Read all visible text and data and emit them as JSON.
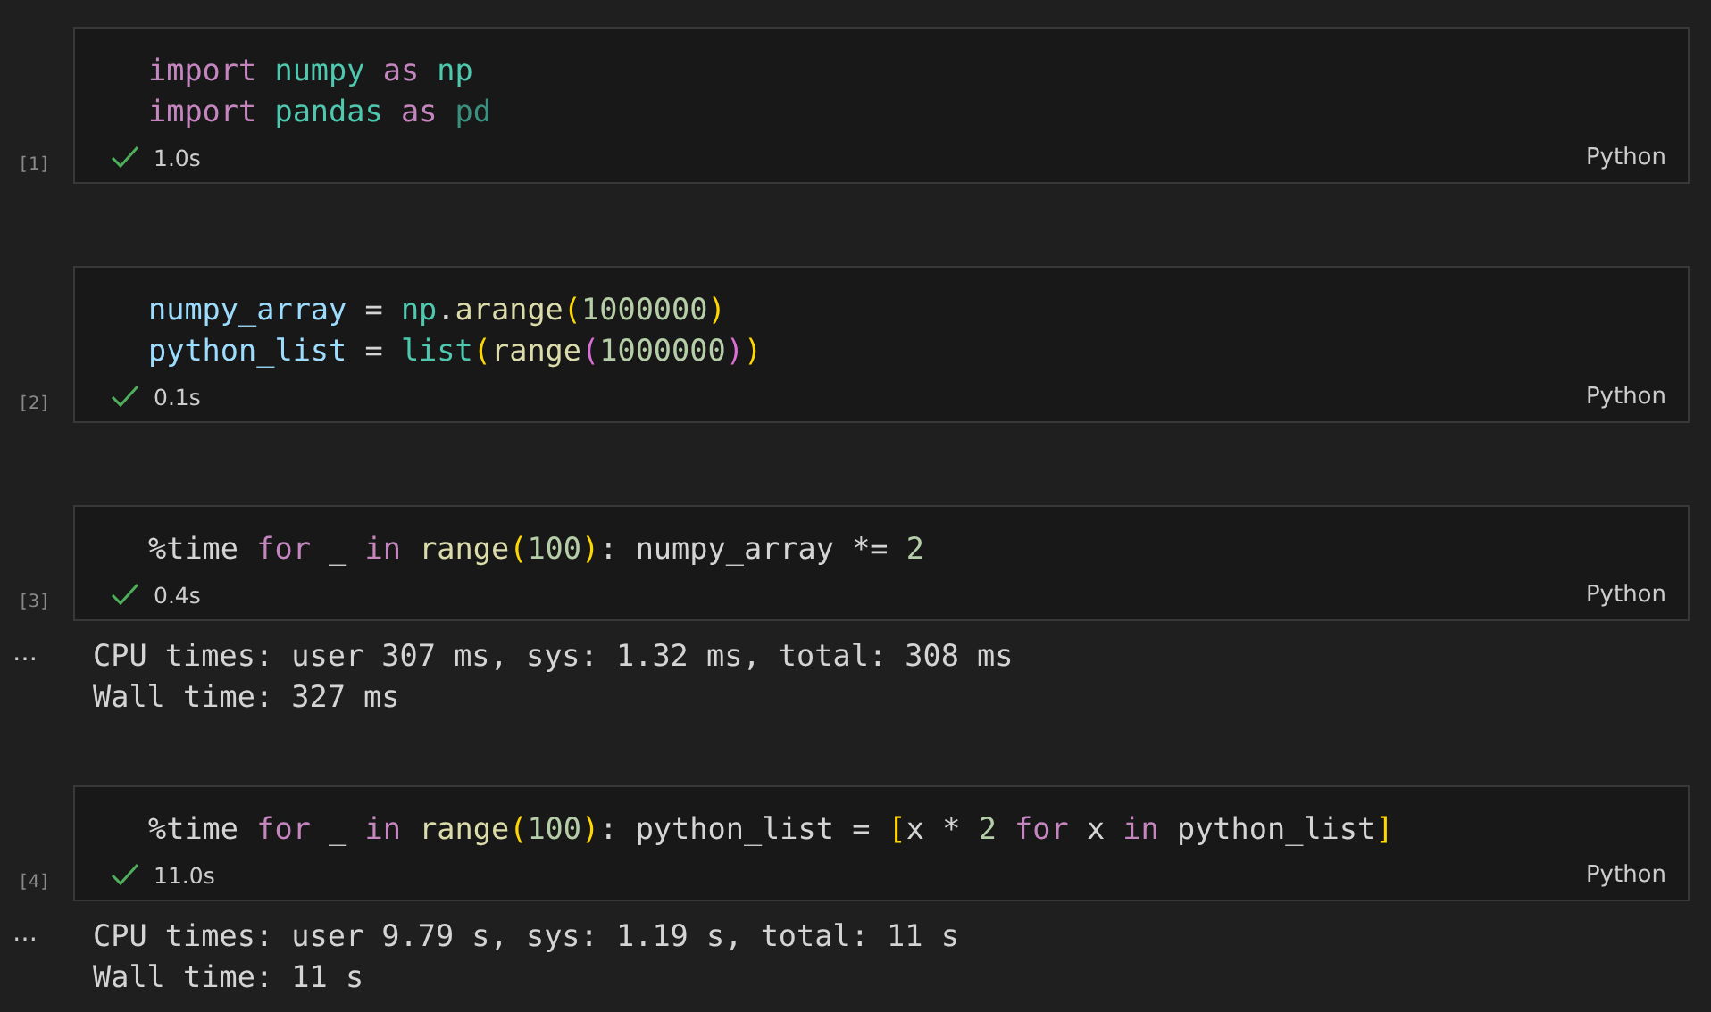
{
  "cells": [
    {
      "exec_count": "[1]",
      "succeeded": true,
      "duration": "1.0s",
      "language": "Python",
      "lines": [
        [
          {
            "text": "import",
            "kind": "keyword"
          },
          {
            "text": " numpy",
            "kind": "module"
          },
          {
            "text": " as",
            "kind": "keyword"
          },
          {
            "text": " np",
            "kind": "module"
          }
        ],
        [
          {
            "text": "import",
            "kind": "keyword"
          },
          {
            "text": " pandas",
            "kind": "module"
          },
          {
            "text": " as",
            "kind": "keyword"
          },
          {
            "text": " pd",
            "kind": "unused"
          }
        ]
      ]
    },
    {
      "exec_count": "[2]",
      "succeeded": true,
      "duration": "0.1s",
      "language": "Python",
      "lines": [
        [
          {
            "text": "numpy_array",
            "kind": "variable"
          },
          {
            "text": " = ",
            "kind": "plain"
          },
          {
            "text": "np",
            "kind": "module"
          },
          {
            "text": ".",
            "kind": "plain"
          },
          {
            "text": "arange",
            "kind": "function"
          },
          {
            "text": "(",
            "kind": "bracket1"
          },
          {
            "text": "1000000",
            "kind": "number"
          },
          {
            "text": ")",
            "kind": "bracket1"
          }
        ],
        [
          {
            "text": "python_list",
            "kind": "variable"
          },
          {
            "text": " = ",
            "kind": "plain"
          },
          {
            "text": "list",
            "kind": "module"
          },
          {
            "text": "(",
            "kind": "bracket1"
          },
          {
            "text": "range",
            "kind": "function"
          },
          {
            "text": "(",
            "kind": "bracket2"
          },
          {
            "text": "1000000",
            "kind": "number"
          },
          {
            "text": ")",
            "kind": "bracket2"
          },
          {
            "text": ")",
            "kind": "bracket1"
          }
        ]
      ]
    },
    {
      "exec_count": "[3]",
      "succeeded": true,
      "duration": "0.4s",
      "language": "Python",
      "lines": [
        [
          {
            "text": "%time ",
            "kind": "plain"
          },
          {
            "text": "for",
            "kind": "keyword"
          },
          {
            "text": " _ ",
            "kind": "plain"
          },
          {
            "text": "in",
            "kind": "keyword"
          },
          {
            "text": " range",
            "kind": "function"
          },
          {
            "text": "(",
            "kind": "bracket1"
          },
          {
            "text": "100",
            "kind": "number"
          },
          {
            "text": ")",
            "kind": "bracket1"
          },
          {
            "text": ": numpy_array *= ",
            "kind": "plain"
          },
          {
            "text": "2",
            "kind": "number"
          }
        ]
      ],
      "output_marker": "…",
      "output": [
        "CPU times: user 307 ms, sys: 1.32 ms, total: 308 ms",
        "Wall time: 327 ms"
      ]
    },
    {
      "exec_count": "[4]",
      "succeeded": true,
      "duration": "11.0s",
      "language": "Python",
      "lines": [
        [
          {
            "text": "%time ",
            "kind": "plain"
          },
          {
            "text": "for",
            "kind": "keyword"
          },
          {
            "text": " _ ",
            "kind": "plain"
          },
          {
            "text": "in",
            "kind": "keyword"
          },
          {
            "text": " range",
            "kind": "function"
          },
          {
            "text": "(",
            "kind": "bracket1"
          },
          {
            "text": "100",
            "kind": "number"
          },
          {
            "text": ")",
            "kind": "bracket1"
          },
          {
            "text": ": python_list = ",
            "kind": "plain"
          },
          {
            "text": "[",
            "kind": "bracket1"
          },
          {
            "text": "x * ",
            "kind": "plain"
          },
          {
            "text": "2",
            "kind": "number"
          },
          {
            "text": " for",
            "kind": "keyword"
          },
          {
            "text": " x ",
            "kind": "plain"
          },
          {
            "text": "in",
            "kind": "keyword"
          },
          {
            "text": " python_list",
            "kind": "plain"
          },
          {
            "text": "]",
            "kind": "bracket1"
          }
        ]
      ],
      "output_marker": "…",
      "output": [
        "CPU times: user 9.79 s, sys: 1.19 s, total: 11 s",
        "Wall time: 11 s"
      ]
    }
  ]
}
